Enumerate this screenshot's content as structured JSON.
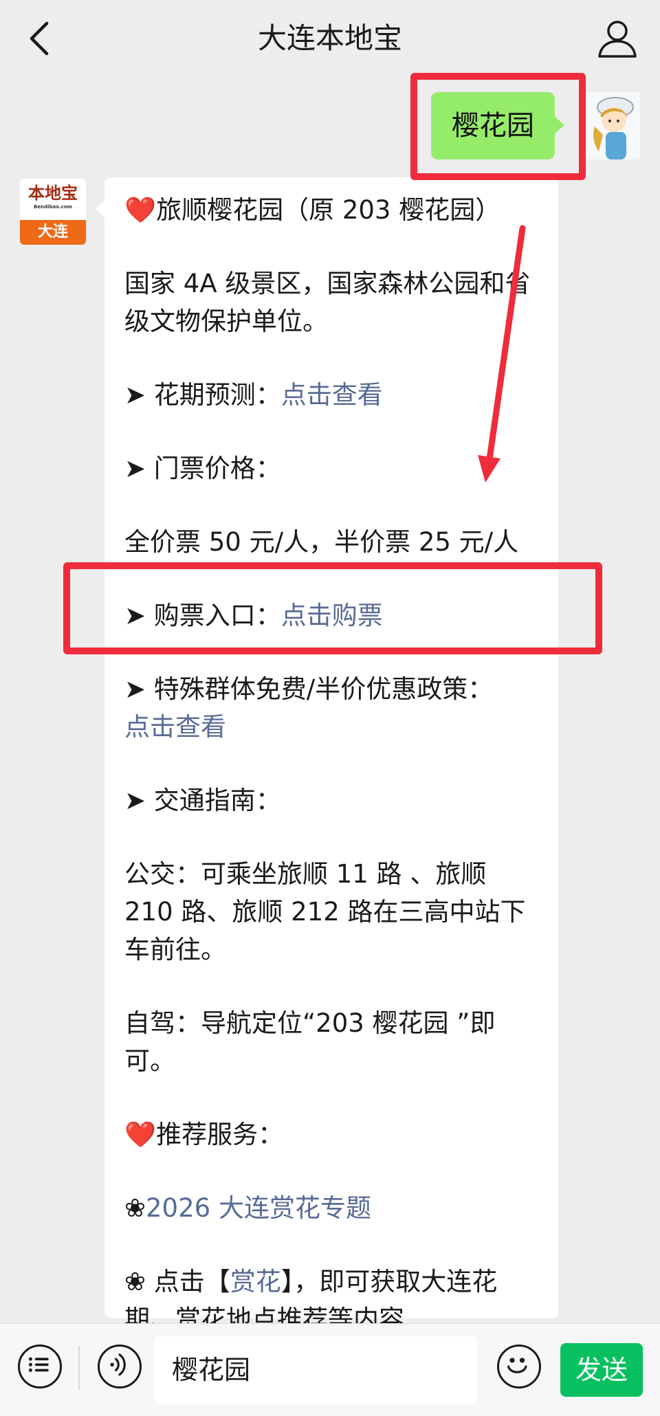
{
  "header": {
    "title": "大连本地宝",
    "back_icon": "chevron-left-icon",
    "profile_icon": "user-icon"
  },
  "outgoing": {
    "text": "樱花园"
  },
  "bot_avatar": {
    "brand": "本地宝",
    "domain": "Bendibao.com",
    "city": "大连"
  },
  "message": {
    "line1_heart": "❤️",
    "line1": "旅顺樱花园（原 203 樱花园）",
    "desc": "国家 4A 级景区，国家森林公园和省级文物保护单位。",
    "flower_label": "➤ 花期预测：",
    "flower_link": "点击查看",
    "ticket_label": "➤ 门票价格：",
    "ticket_price": "全价票 50 元/人，半价票 25 元/人",
    "buy_label": "➤ 购票入口：",
    "buy_link": "点击购票",
    "special_label": "➤ 特殊群体免费/半价优惠政策：",
    "special_link": "点击查看",
    "traffic_label": "➤ 交通指南：",
    "bus": "公交：可乘坐旅顺 11 路 、旅顺 210 路、旅顺 212 路在三高中站下车前往。",
    "drive": "自驾：导航定位“203 樱花园 ”即可。",
    "recommend_heart": "❤️",
    "recommend": "推荐服务：",
    "topic_prefix": "❀",
    "topic_link": "2026 大连赏花专题",
    "click_prefix": "❀ 点击【",
    "click_link": "赏花",
    "click_suffix": "】，即可获取大连花期、赏花地点推荐等内容"
  },
  "input_bar": {
    "menu_icon": "list-icon",
    "voice_icon": "voice-icon",
    "input_value": "樱花园",
    "emoji_icon": "smiley-icon",
    "send_label": "发送"
  },
  "colors": {
    "background": "#ededed",
    "outgoing_bubble": "#95ec69",
    "link": "#576b95",
    "annotation": "#ee2c3c",
    "send_button": "#07c160",
    "avatar_orange": "#ee6a16"
  }
}
